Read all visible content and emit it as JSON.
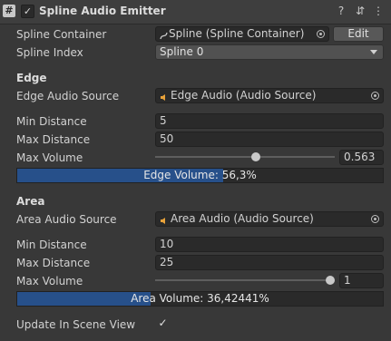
{
  "header": {
    "script_icon": "#",
    "enabled_check": "✓",
    "title": "Spline Audio Emitter",
    "help_icon": "?",
    "presets_icon": "⇵",
    "menu_icon": "⋮"
  },
  "spline_container": {
    "label": "Spline Container",
    "value": "Spline (Spline Container)",
    "edit_label": "Edit"
  },
  "spline_index": {
    "label": "Spline Index",
    "value": "Spline 0"
  },
  "edge": {
    "section": "Edge",
    "audio_source_label": "Edge Audio Source",
    "audio_source_value": "Edge Audio (Audio Source)",
    "min_distance_label": "Min Distance",
    "min_distance": "5",
    "max_distance_label": "Max Distance",
    "max_distance": "50",
    "max_volume_label": "Max Volume",
    "max_volume": "0.563",
    "volume_bar_text": "Edge Volume: 56,3%",
    "volume_fraction": 0.563
  },
  "area": {
    "section": "Area",
    "audio_source_label": "Area Audio Source",
    "audio_source_value": "Area Audio (Audio Source)",
    "min_distance_label": "Min Distance",
    "min_distance": "10",
    "max_distance_label": "Max Distance",
    "max_distance": "25",
    "max_volume_label": "Max Volume",
    "max_volume": "1",
    "volume_bar_text": "Area Volume: 36,42441%",
    "volume_fraction": 0.3642441
  },
  "update_in_scene_view": {
    "label": "Update In Scene View",
    "checked": "✓"
  },
  "colors": {
    "accent": "#27508a",
    "background": "#383838",
    "audio_icon": "#e8a23a"
  }
}
